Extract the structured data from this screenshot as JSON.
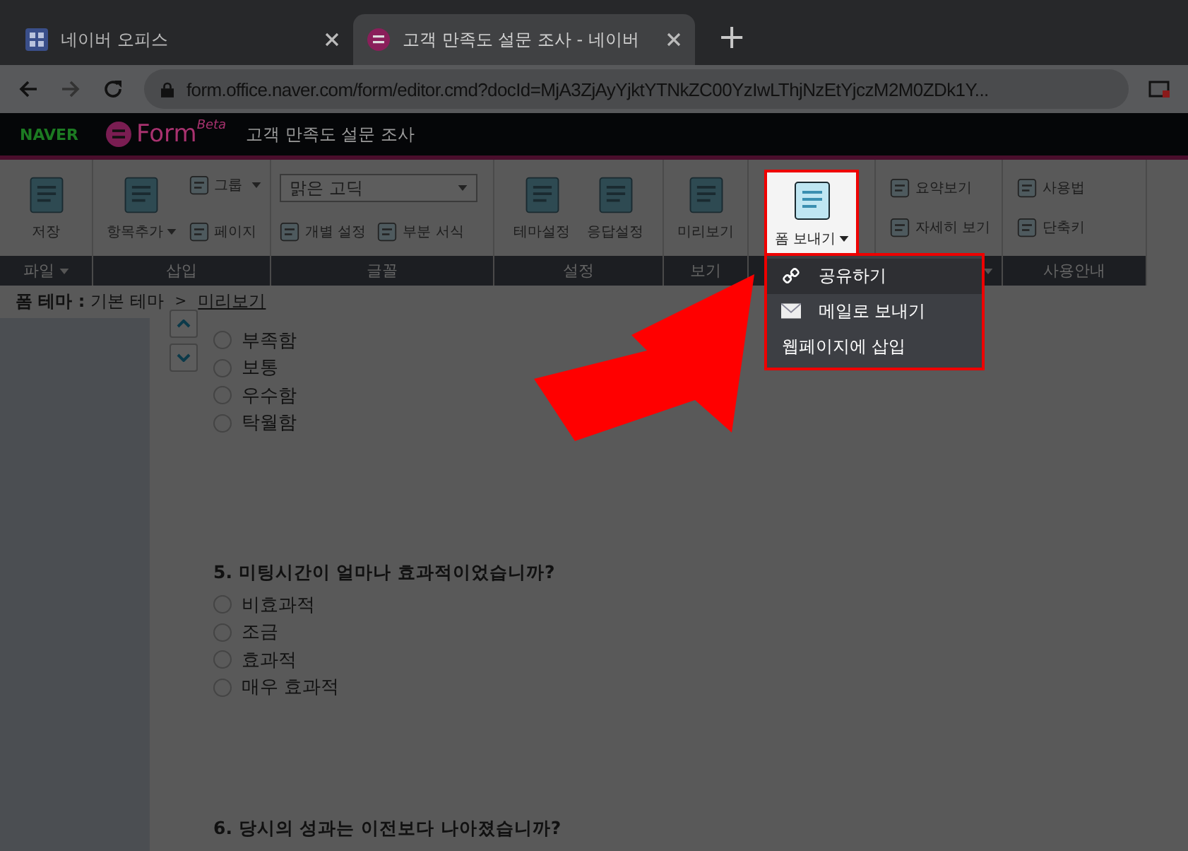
{
  "browser": {
    "tabs": [
      {
        "title": "네이버 오피스",
        "selected": false
      },
      {
        "title": "고객 만족도 설문 조사 - 네이버",
        "selected": true
      }
    ],
    "new_tab": "+",
    "url": "form.office.naver.com/form/editor.cmd?docId=MjA3ZjAyYjktYTNkZC00YzIwLThjNzEtYjczM2M0ZDk1Y..."
  },
  "app_header": {
    "brand": "NAVER",
    "product": "Form",
    "badge": "Beta",
    "document_title": "고객 만족도 설문 조사"
  },
  "ribbon": {
    "groups": [
      {
        "label": "파일",
        "menu": true,
        "items": [
          {
            "kind": "large",
            "label": "저장",
            "menu": false
          }
        ]
      },
      {
        "label": "삽입",
        "menu": false,
        "items": [
          {
            "kind": "large",
            "label": "항목추가",
            "menu": true
          },
          {
            "kind": "small",
            "label": "그룹",
            "menu": true
          },
          {
            "kind": "small",
            "label": "페이지",
            "menu": false
          }
        ]
      },
      {
        "label": "글꼴",
        "menu": false,
        "items": [
          {
            "kind": "select",
            "label": "맑은 고딕",
            "menu": true
          },
          {
            "kind": "inline",
            "label": "개별 설정",
            "menu": false
          },
          {
            "kind": "inline",
            "label": "부분 서식",
            "menu": false
          }
        ]
      },
      {
        "label": "설정",
        "menu": false,
        "items": [
          {
            "kind": "large",
            "label": "테마설정",
            "menu": false
          },
          {
            "kind": "large",
            "label": "응답설정",
            "menu": false
          }
        ]
      },
      {
        "label": "보기",
        "menu": false,
        "items": [
          {
            "kind": "large",
            "label": "미리보기",
            "menu": false
          }
        ]
      },
      {
        "menu": false,
        "items": [
          {
            "kind": "large",
            "label": "폼 보내기",
            "menu": true,
            "expanded": true
          }
        ]
      },
      {
        "menu": true,
        "items": [
          {
            "kind": "small",
            "label": "요약보기",
            "menu": false
          },
          {
            "kind": "small",
            "label": "자세히 보기",
            "menu": false
          }
        ]
      },
      {
        "label": "사용안내",
        "menu": false,
        "items": [
          {
            "kind": "small",
            "label": "사용법",
            "menu": false
          },
          {
            "kind": "small",
            "label": "단축키",
            "menu": false
          }
        ]
      }
    ]
  },
  "send_menu": {
    "items": [
      {
        "kind": "link",
        "label": "공유하기",
        "selected": true
      },
      {
        "kind": "mail",
        "label": "메일로 보내기",
        "selected": false
      },
      {
        "kind": "plain",
        "label": "웹페이지에 삽입",
        "selected": false
      }
    ]
  },
  "breadcrumb": {
    "theme_label": "폼 테마 :",
    "theme": "기본 테마",
    "separator": ">",
    "link": "미리보기"
  },
  "questions": [
    {
      "options": [
        {
          "label": "부족함",
          "selected": false
        },
        {
          "label": "보통",
          "selected": false
        },
        {
          "label": "우수함",
          "selected": false
        },
        {
          "label": "탁월함",
          "selected": false
        }
      ],
      "reorder": true
    },
    {
      "title": "5. 미팅시간이 얼마나 효과적이었습니까?",
      "options": [
        {
          "label": "비효과적",
          "selected": false
        },
        {
          "label": "조금",
          "selected": false
        },
        {
          "label": "효과적",
          "selected": false
        },
        {
          "label": "매우 효과적",
          "selected": false
        }
      ],
      "reorder": false
    },
    {
      "title": "6. 당시의 성과는 이전보다 나아졌습니까?",
      "reorder": false
    }
  ]
}
